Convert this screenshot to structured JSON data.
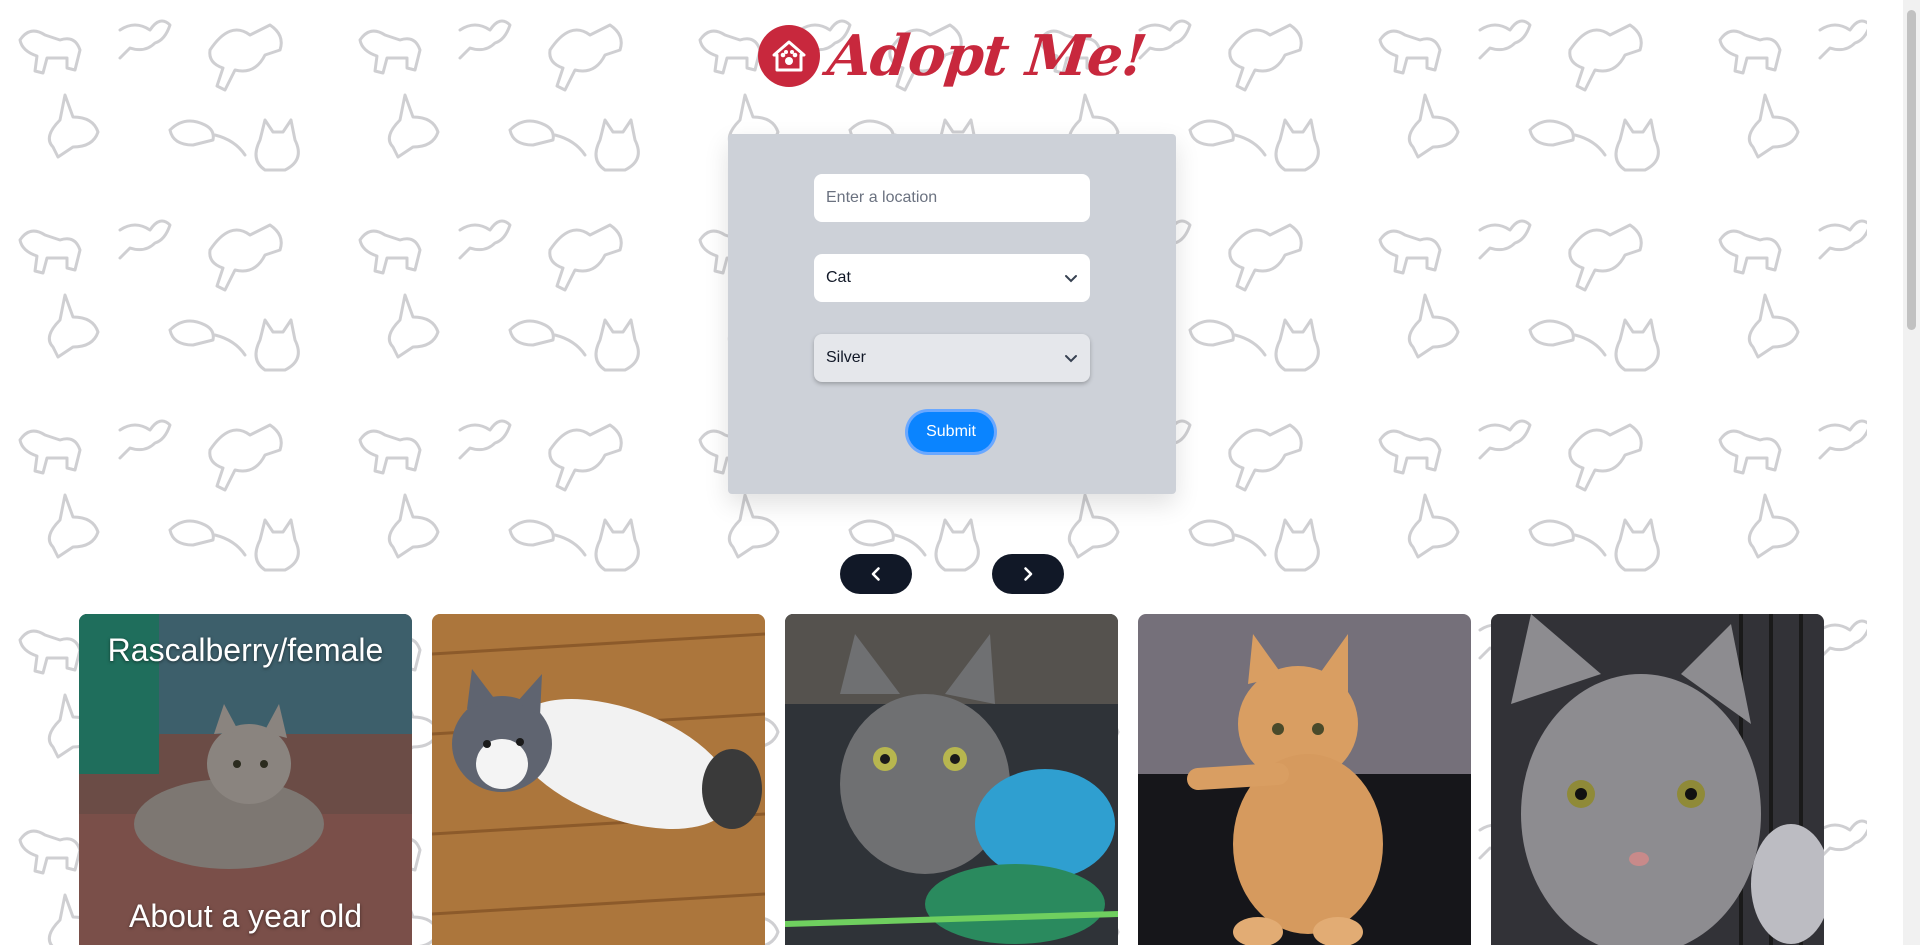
{
  "brand": {
    "logo_text": "Adopt Me!",
    "logo_color": "#c8283d",
    "logo_icon": "home-paw-icon"
  },
  "search": {
    "location_placeholder": "Enter a location",
    "animal_value": "Cat",
    "breed_value": "Silver",
    "submit_label": "Submit",
    "submit_color": "#0a84ff"
  },
  "carousel": {
    "prev_icon": "chevron-left-icon",
    "next_icon": "chevron-right-icon"
  },
  "pets": [
    {
      "overlay_name": "Rascalberry/female",
      "overlay_age": "About a year old"
    },
    {
      "overlay_name": "",
      "overlay_age": ""
    },
    {
      "overlay_name": "",
      "overlay_age": ""
    },
    {
      "overlay_name": "",
      "overlay_age": ""
    },
    {
      "overlay_name": "",
      "overlay_age": ""
    }
  ]
}
